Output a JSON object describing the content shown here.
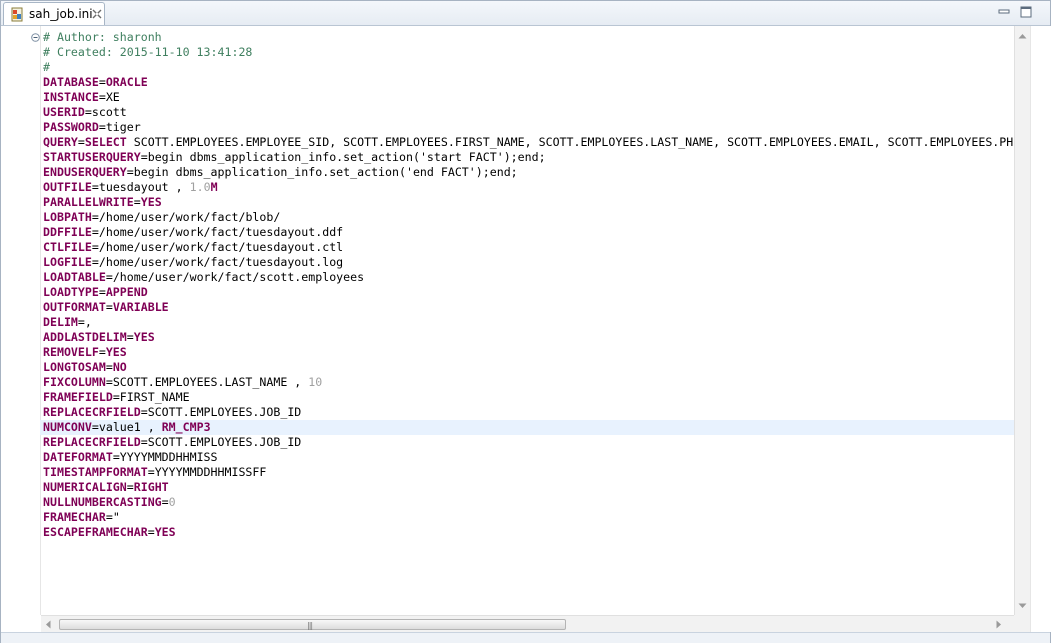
{
  "tab": {
    "title": "sah_job.ini"
  },
  "editor": {
    "lines": [
      [
        {
          "t": "# Author: sharonh",
          "c": "comment"
        }
      ],
      [
        {
          "t": "# Created: 2015-11-10 13:41:28",
          "c": "comment"
        }
      ],
      [
        {
          "t": "#",
          "c": "comment"
        }
      ],
      [
        {
          "t": "DATABASE",
          "c": "key"
        },
        {
          "t": "=",
          "c": "eq"
        },
        {
          "t": "ORACLE",
          "c": "kw"
        }
      ],
      [
        {
          "t": "INSTANCE",
          "c": "key"
        },
        {
          "t": "=",
          "c": "eq"
        },
        {
          "t": "XE",
          "c": "val"
        }
      ],
      [
        {
          "t": "USERID",
          "c": "key"
        },
        {
          "t": "=",
          "c": "eq"
        },
        {
          "t": "scott",
          "c": "val"
        }
      ],
      [
        {
          "t": "PASSWORD",
          "c": "key"
        },
        {
          "t": "=",
          "c": "eq"
        },
        {
          "t": "tiger",
          "c": "val"
        }
      ],
      [
        {
          "t": "QUERY",
          "c": "key"
        },
        {
          "t": "=",
          "c": "eq"
        },
        {
          "t": "SELECT",
          "c": "kw"
        },
        {
          "t": " SCOTT.EMPLOYEES.EMPLOYEE_SID, SCOTT.EMPLOYEES.FIRST_NAME, SCOTT.EMPLOYEES.LAST_NAME, SCOTT.EMPLOYEES.EMAIL, SCOTT.EMPLOYEES.PH",
          "c": "val"
        }
      ],
      [
        {
          "t": "STARTUSERQUERY",
          "c": "key"
        },
        {
          "t": "=",
          "c": "eq"
        },
        {
          "t": "begin dbms_application_info.set_action('start FACT');end;",
          "c": "val"
        }
      ],
      [
        {
          "t": "ENDUSERQUERY",
          "c": "key"
        },
        {
          "t": "=",
          "c": "eq"
        },
        {
          "t": "begin dbms_application_info.set_action('end FACT');end;",
          "c": "val"
        }
      ],
      [
        {
          "t": "OUTFILE",
          "c": "key"
        },
        {
          "t": "=",
          "c": "eq"
        },
        {
          "t": "tuesdayout , ",
          "c": "val"
        },
        {
          "t": "1.0",
          "c": "num"
        },
        {
          "t": "M",
          "c": "kw"
        }
      ],
      [
        {
          "t": "PARALLELWRITE",
          "c": "key"
        },
        {
          "t": "=",
          "c": "eq"
        },
        {
          "t": "YES",
          "c": "kw"
        }
      ],
      [
        {
          "t": "LOBPATH",
          "c": "key"
        },
        {
          "t": "=",
          "c": "eq"
        },
        {
          "t": "/home/user/work/fact/blob/",
          "c": "val"
        }
      ],
      [
        {
          "t": "DDFFILE",
          "c": "key"
        },
        {
          "t": "=",
          "c": "eq"
        },
        {
          "t": "/home/user/work/fact/tuesdayout.ddf",
          "c": "val"
        }
      ],
      [
        {
          "t": "CTLFILE",
          "c": "key"
        },
        {
          "t": "=",
          "c": "eq"
        },
        {
          "t": "/home/user/work/fact/tuesdayout.ctl",
          "c": "val"
        }
      ],
      [
        {
          "t": "LOGFILE",
          "c": "key"
        },
        {
          "t": "=",
          "c": "eq"
        },
        {
          "t": "/home/user/work/fact/tuesdayout.log",
          "c": "val"
        }
      ],
      [
        {
          "t": "LOADTABLE",
          "c": "key"
        },
        {
          "t": "=",
          "c": "eq"
        },
        {
          "t": "/home/user/work/fact/scott.employees",
          "c": "val"
        }
      ],
      [
        {
          "t": "LOADTYPE",
          "c": "key"
        },
        {
          "t": "=",
          "c": "eq"
        },
        {
          "t": "APPEND",
          "c": "kw"
        }
      ],
      [
        {
          "t": "OUTFORMAT",
          "c": "key"
        },
        {
          "t": "=",
          "c": "eq"
        },
        {
          "t": "VARIABLE",
          "c": "kw"
        }
      ],
      [
        {
          "t": "DELIM",
          "c": "key"
        },
        {
          "t": "=",
          "c": "eq"
        },
        {
          "t": ",",
          "c": "val"
        }
      ],
      [
        {
          "t": "ADDLASTDELIM",
          "c": "key"
        },
        {
          "t": "=",
          "c": "eq"
        },
        {
          "t": "YES",
          "c": "kw"
        }
      ],
      [
        {
          "t": "REMOVELF",
          "c": "key"
        },
        {
          "t": "=",
          "c": "eq"
        },
        {
          "t": "YES",
          "c": "kw"
        }
      ],
      [
        {
          "t": "LONGTOSAM",
          "c": "key"
        },
        {
          "t": "=",
          "c": "eq"
        },
        {
          "t": "NO",
          "c": "kw"
        }
      ],
      [
        {
          "t": "FIXCOLUMN",
          "c": "key"
        },
        {
          "t": "=",
          "c": "eq"
        },
        {
          "t": "SCOTT.EMPLOYEES.LAST_NAME , ",
          "c": "val"
        },
        {
          "t": "10",
          "c": "num"
        }
      ],
      [
        {
          "t": "FRAMEFIELD",
          "c": "key"
        },
        {
          "t": "=",
          "c": "eq"
        },
        {
          "t": "FIRST_NAME",
          "c": "val"
        }
      ],
      [
        {
          "t": "REPLACECRFIELD",
          "c": "key"
        },
        {
          "t": "=",
          "c": "eq"
        },
        {
          "t": "SCOTT.EMPLOYEES.JOB_ID",
          "c": "val"
        }
      ],
      [
        {
          "t": "NUMCONV",
          "c": "key"
        },
        {
          "t": "=",
          "c": "eq"
        },
        {
          "t": "value1 , ",
          "c": "val"
        },
        {
          "t": "RM_CMP3",
          "c": "kw"
        }
      ],
      [
        {
          "t": "REPLACECRFIELD",
          "c": "key"
        },
        {
          "t": "=",
          "c": "eq"
        },
        {
          "t": "SCOTT.EMPLOYEES.JOB_ID",
          "c": "val"
        }
      ],
      [
        {
          "t": "DATEFORMAT",
          "c": "key"
        },
        {
          "t": "=",
          "c": "eq"
        },
        {
          "t": "YYYYMMDDHHMISS",
          "c": "val"
        }
      ],
      [
        {
          "t": "TIMESTAMPFORMAT",
          "c": "key"
        },
        {
          "t": "=",
          "c": "eq"
        },
        {
          "t": "YYYYMMDDHHMISSFF",
          "c": "val"
        }
      ],
      [
        {
          "t": "NUMERICALIGN",
          "c": "key"
        },
        {
          "t": "=",
          "c": "eq"
        },
        {
          "t": "RIGHT",
          "c": "kw"
        }
      ],
      [
        {
          "t": "NULLNUMBERCASTING",
          "c": "key"
        },
        {
          "t": "=",
          "c": "eq"
        },
        {
          "t": "0",
          "c": "num"
        }
      ],
      [
        {
          "t": "FRAMECHAR",
          "c": "key"
        },
        {
          "t": "=",
          "c": "eq"
        },
        {
          "t": "\"",
          "c": "val"
        }
      ],
      [
        {
          "t": "ESCAPEFRAMECHAR",
          "c": "key"
        },
        {
          "t": "=",
          "c": "eq"
        },
        {
          "t": "YES",
          "c": "kw"
        }
      ]
    ],
    "current_line": 26
  },
  "colors": {
    "comment": "#3f7f5f",
    "key": "#7f0055",
    "number": "#a0a0a0",
    "current_line": "#e8f2fe"
  },
  "icons": {
    "tab": "ini-file-icon",
    "close": "close-icon",
    "fold": "collapse-minus-icon",
    "minimize": "minimize-icon",
    "maximize": "maximize-icon"
  }
}
